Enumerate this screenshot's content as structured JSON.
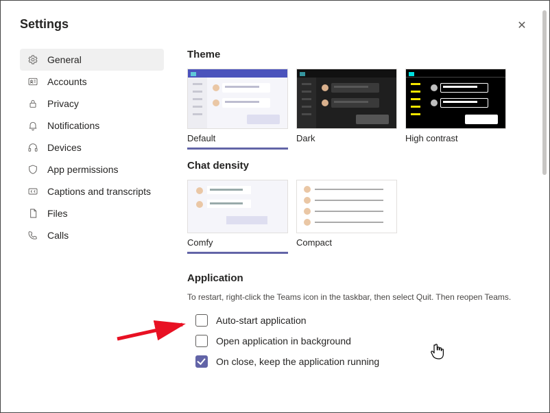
{
  "title": "Settings",
  "sidebar": {
    "items": [
      {
        "label": "General",
        "icon": "gear-icon",
        "active": true
      },
      {
        "label": "Accounts",
        "icon": "id-card-icon",
        "active": false
      },
      {
        "label": "Privacy",
        "icon": "lock-icon",
        "active": false
      },
      {
        "label": "Notifications",
        "icon": "bell-icon",
        "active": false
      },
      {
        "label": "Devices",
        "icon": "headset-icon",
        "active": false
      },
      {
        "label": "App permissions",
        "icon": "shield-icon",
        "active": false
      },
      {
        "label": "Captions and transcripts",
        "icon": "cc-icon",
        "active": false
      },
      {
        "label": "Files",
        "icon": "file-icon",
        "active": false
      },
      {
        "label": "Calls",
        "icon": "phone-icon",
        "active": false
      }
    ]
  },
  "theme": {
    "heading": "Theme",
    "options": [
      {
        "label": "Default",
        "selected": true
      },
      {
        "label": "Dark",
        "selected": false
      },
      {
        "label": "High contrast",
        "selected": false
      }
    ]
  },
  "density": {
    "heading": "Chat density",
    "options": [
      {
        "label": "Comfy",
        "selected": true
      },
      {
        "label": "Compact",
        "selected": false
      }
    ]
  },
  "application": {
    "heading": "Application",
    "hint": "To restart, right-click the Teams icon in the taskbar, then select Quit. Then reopen Teams.",
    "opts": [
      {
        "label": "Auto-start application",
        "checked": false
      },
      {
        "label": "Open application in background",
        "checked": false
      },
      {
        "label": "On close, keep the application running",
        "checked": true
      }
    ]
  },
  "colors": {
    "accent": "#6264a7"
  }
}
